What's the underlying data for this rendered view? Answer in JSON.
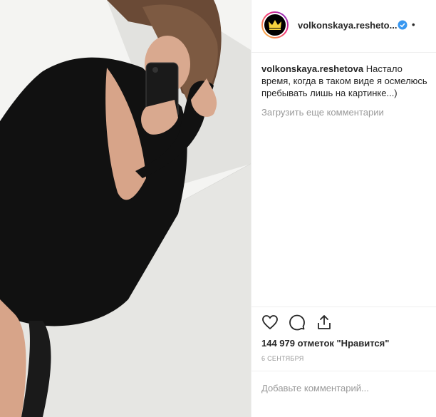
{
  "post": {
    "username": "volkonskaya.resheto...",
    "options_dot": "•",
    "caption_user": "volkonskaya.reshetova",
    "caption_text": "Настало время, когда в таком виде я осмелюсь пребывать лишь на картинке...)",
    "load_more": "Загрузить еще комментарии",
    "likes": "144 979 отметок \"Нравится\"",
    "date": "6 СЕНТЯБРЯ",
    "comment_placeholder": "Добавьте комментарий..."
  },
  "icons": {
    "avatar": "crown-logo",
    "verified": "verified-badge-icon",
    "like": "heart-icon",
    "comment": "comment-icon",
    "share": "share-icon"
  },
  "colors": {
    "verified": "#3897f0",
    "crown": "#f7d23e",
    "muted": "#999999"
  }
}
